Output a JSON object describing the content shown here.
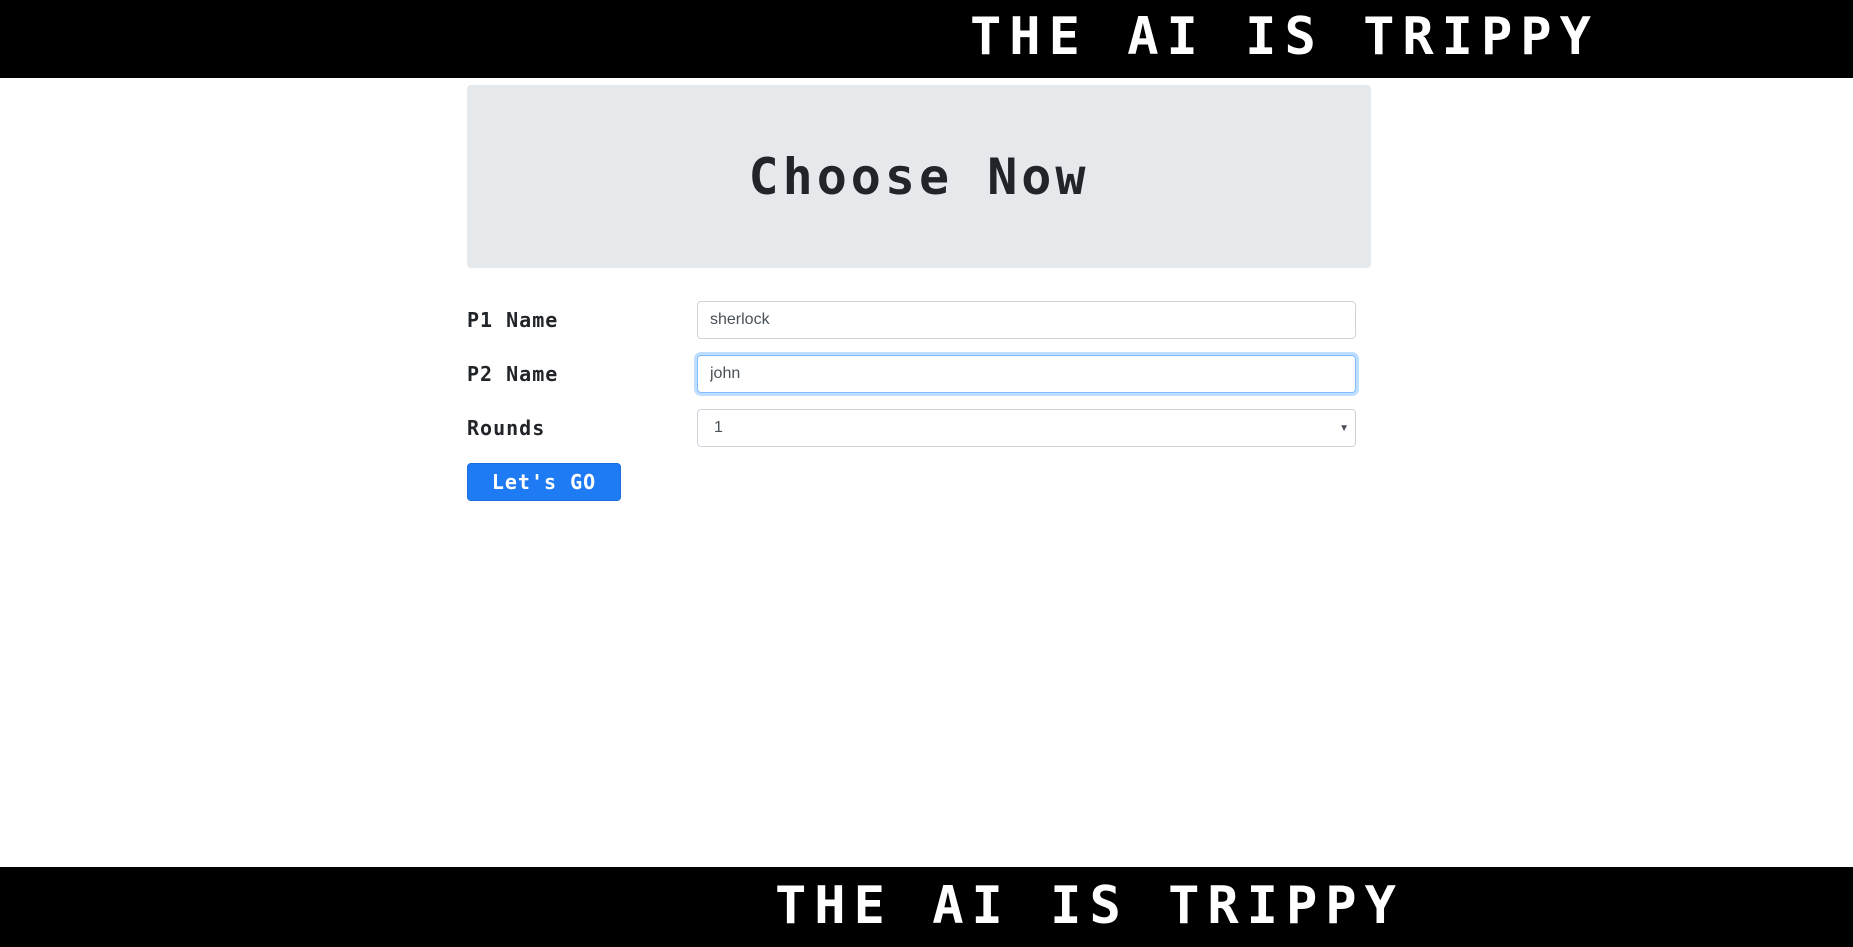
{
  "header": {
    "banner_text": "THE AI IS TRIPPY"
  },
  "footer": {
    "banner_text": "THE AI IS TRIPPY"
  },
  "jumbotron": {
    "title": "Choose Now"
  },
  "form": {
    "p1": {
      "label": "P1 Name",
      "value": "sherlock"
    },
    "p2": {
      "label": "P2 Name",
      "value": "john"
    },
    "rounds": {
      "label": "Rounds",
      "selected": "1"
    },
    "submit_label": "Let's GO"
  },
  "colors": {
    "banner_bg": "#000000",
    "banner_text": "#ffffff",
    "jumbotron_bg": "#e6e9ec",
    "button_bg": "#1f7bf3",
    "focus_border": "#80bdff"
  },
  "icons": {
    "rounds_select_caret": "chevron-down-icon"
  }
}
